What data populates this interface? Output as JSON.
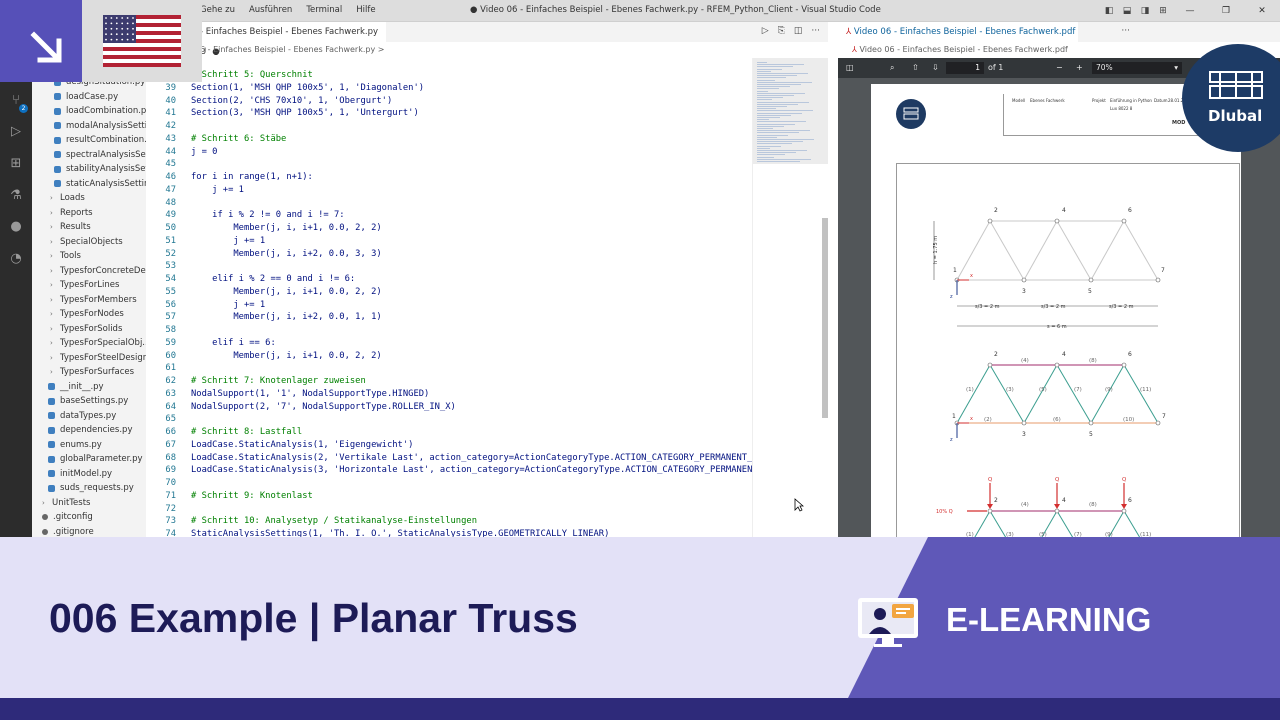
{
  "window": {
    "menu": [
      "Gehe zu",
      "Ausführen",
      "Terminal",
      "Hilfe"
    ],
    "title": "● Video 06 - Einfaches Beispiel - Ebenes Fachwerk.py - RFEM_Python_Client - Visual Studio Code"
  },
  "activity": {
    "badge_count": "2"
  },
  "explorer": {
    "files_top": [
      "designSituation.py",
      "loadCase.py",
      "loadCombination.py",
      "modalAnalysisSetti...",
      "resultCombination...",
      "spectralAnalysisSet...",
      "stabilityAnalysisSet...",
      "staticAnalysisSettin..."
    ],
    "folders": [
      "Loads",
      "Reports",
      "Results",
      "SpecialObjects",
      "Tools",
      "TypesforConcreteDe...",
      "TypesForLines",
      "TypesForMembers",
      "TypesForNodes",
      "TypesForSolids",
      "TypesForSpecialObj...",
      "TypesForSteelDesign",
      "TypesForSurfaces"
    ],
    "files_bottom": [
      "__init__.py",
      "baseSettings.py",
      "dataTypes.py",
      "dependencies.py",
      "enums.py",
      "globalParameter.py",
      "initModel.py",
      "suds_requests.py"
    ],
    "root_items": [
      "UnitTests",
      ".gitconfig",
      ".gitignore"
    ]
  },
  "editor": {
    "tab_label": "- Einfaches Beispiel - Ebenes Fachwerk.py U",
    "tab_modified": "●",
    "breadcrumb": "6 - Einfaches Beispiel - Ebenes Fachwerk.py >",
    "lines": [
      {
        "n": "",
        "t": "# Schritt 5: Querschnit"
      },
      {
        "n": "39",
        "t": "Section(1, 'MSH QHP 100x5', 1, 'Diagonalen')"
      },
      {
        "n": "40",
        "t": "Section(2, 'CHS 70x10', 1, 'Obergurt')"
      },
      {
        "n": "41",
        "t": "Section(3, 'MSH QHP 100x5', 1, 'Untergurt')"
      },
      {
        "n": "42",
        "t": ""
      },
      {
        "n": "43",
        "t": "# Schritt 6: Stäbe"
      },
      {
        "n": "44",
        "t": "j = 0"
      },
      {
        "n": "45",
        "t": ""
      },
      {
        "n": "46",
        "t": "for i in range(1, n+1):"
      },
      {
        "n": "47",
        "t": "    j += 1"
      },
      {
        "n": "48",
        "t": ""
      },
      {
        "n": "49",
        "t": "    if i % 2 != 0 and i != 7:"
      },
      {
        "n": "50",
        "t": "        Member(j, i, i+1, 0.0, 2, 2)"
      },
      {
        "n": "51",
        "t": "        j += 1"
      },
      {
        "n": "52",
        "t": "        Member(j, i, i+2, 0.0, 3, 3)"
      },
      {
        "n": "53",
        "t": ""
      },
      {
        "n": "54",
        "t": "    elif i % 2 == 0 and i != 6:"
      },
      {
        "n": "55",
        "t": "        Member(j, i, i+1, 0.0, 2, 2)"
      },
      {
        "n": "56",
        "t": "        j += 1"
      },
      {
        "n": "57",
        "t": "        Member(j, i, i+2, 0.0, 1, 1)"
      },
      {
        "n": "58",
        "t": ""
      },
      {
        "n": "59",
        "t": "    elif i == 6:"
      },
      {
        "n": "60",
        "t": "        Member(j, i, i+1, 0.0, 2, 2)"
      },
      {
        "n": "61",
        "t": ""
      },
      {
        "n": "62",
        "t": "# Schritt 7: Knotenlager zuweisen"
      },
      {
        "n": "63",
        "t": "NodalSupport(1, '1', NodalSupportType.HINGED)"
      },
      {
        "n": "64",
        "t": "NodalSupport(2, '7', NodalSupportType.ROLLER_IN_X)"
      },
      {
        "n": "65",
        "t": ""
      },
      {
        "n": "66",
        "t": "# Schritt 8: Lastfall"
      },
      {
        "n": "67",
        "t": "LoadCase.StaticAnalysis(1, 'Eigengewicht')"
      },
      {
        "n": "68",
        "t": "LoadCase.StaticAnalysis(2, 'Vertikale Last', action_category=ActionCategoryType.ACTION_CATEGORY_PERMANENT_IMP"
      },
      {
        "n": "69",
        "t": "LoadCase.StaticAnalysis(3, 'Horizontale Last', action_category=ActionCategoryType.ACTION_CATEGORY_PERMANENT_I"
      },
      {
        "n": "70",
        "t": ""
      },
      {
        "n": "71",
        "t": "# Schritt 9: Knotenlast"
      },
      {
        "n": "72",
        "t": ""
      },
      {
        "n": "73",
        "t": "# Schritt 10: Analysetyp / Statikanalyse-Einstellungen"
      },
      {
        "n": "74",
        "t": "StaticAnalysisSettings(1, 'Th. I. O.', StaticAnalysisType.GEOMETRICALLY_LINEAR)"
      }
    ]
  },
  "pdf": {
    "tab_label": "Video 06 - Einfaches Beispiel - Ebenes Fachwerk.pdf U",
    "breadcrumb": "Video 06 - Einfaches Beispiel - Ebenes Fachwerk.pdf",
    "page_number": "1",
    "page_total": "of 1",
    "zoom": "70%",
    "header": {
      "model_label": "Modell",
      "model_value": "Ebenes Fachwerk",
      "project_label": "Projekt",
      "project_value": "Einführung in Python",
      "date_label": "Datum",
      "date_value": "28.01.2022",
      "sub_value": "Lux 8022 8",
      "mod_label": "MOD"
    },
    "logo_text": "Dlubal",
    "drawing1": {
      "node_labels": [
        "1",
        "2",
        "3",
        "4",
        "5",
        "6",
        "7"
      ],
      "height_label": "h = 1.75 m",
      "spans": [
        "s/3 = 2 m",
        "s/3 = 2 m",
        "s/3 = 2 m"
      ],
      "total": "s = 6 m",
      "axis_x": "x",
      "axis_z": "z"
    },
    "drawing2": {
      "node_labels": [
        "1",
        "2",
        "3",
        "4",
        "5",
        "6",
        "7"
      ],
      "member_labels": [
        "(1)",
        "(2)",
        "(3)",
        "(4)",
        "(5)",
        "(6)",
        "(7)",
        "(8)",
        "(9)",
        "(10)",
        "(11)"
      ],
      "axis_x": "x",
      "axis_z": "z"
    },
    "drawing3": {
      "load_labels": [
        "Q",
        "Q",
        "Q"
      ],
      "horizontal_label": "10% Q",
      "node_labels": [
        "2",
        "4",
        "6"
      ],
      "member_labels": [
        "(4)",
        "(8)",
        "(1)",
        "(3)",
        "(5)",
        "(7)",
        "(9)",
        "(11)"
      ]
    }
  },
  "brand": {
    "name": "Dlubal"
  },
  "banner": {
    "title": "006 Example | Planar Truss",
    "label": "E-LEARNING"
  },
  "colors": {
    "banner_light": "#e3e1f7",
    "banner_purple": "#5f58b8",
    "banner_text": "#1d1b57",
    "bottom_bar": "#2e2a7a",
    "dlubal_blue": "#1d3b66"
  }
}
